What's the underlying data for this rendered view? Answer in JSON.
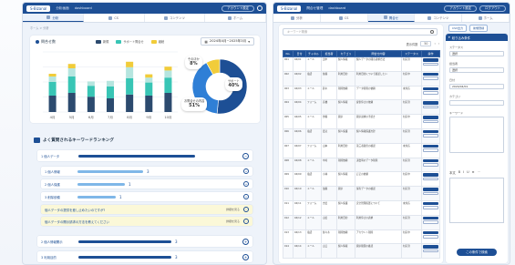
{
  "left": {
    "logo": "S-Bizanal",
    "nav": [
      "分析画面",
      "dashboard"
    ],
    "top_button": "アカウント設定",
    "subnav": [
      "分析",
      "CS",
      "コンテンツ",
      "ホーム"
    ],
    "breadcrumb": "ホーム > 分析",
    "chart_card": {
      "title": "問合せ数",
      "legend": [
        "新規",
        "サポート問合せ",
        "継続"
      ],
      "period": "2024年4月~2025年3月"
    },
    "donut_labels": [
      {
        "label": "そのほか",
        "value": "8%"
      },
      {
        "label": "サポート",
        "value": "40%"
      },
      {
        "label": "お問合せの内容",
        "value": "51%"
      }
    ],
    "ranking": {
      "title": "よく質問されるキーワードランキング",
      "items": [
        {
          "label": "1 個人データ",
          "count": "",
          "level": 1,
          "toggle": "−"
        },
        {
          "label": "1 個人情報",
          "count": "3",
          "level": 2,
          "toggle": "+"
        },
        {
          "label": "2 個人保護",
          "count": "1",
          "level": 2,
          "toggle": "+"
        },
        {
          "label": "3 削除依頼",
          "count": "1",
          "level": 2,
          "toggle": "+"
        },
        {
          "label": "個人データの提供を差し止めたいのですが?",
          "count": "",
          "level": 3,
          "ext": "詳細を見る"
        },
        {
          "label": "個人データの開示請求の方法を教えてください",
          "count": "",
          "level": 3,
          "ext": "詳細を見る"
        },
        {
          "label": "2 個人情報開示",
          "count": "3",
          "level": 1,
          "toggle": "+"
        },
        {
          "label": "3 利用目的",
          "count": "3",
          "level": 1,
          "toggle": "+"
        }
      ]
    }
  },
  "right": {
    "logo": "S-Bizanal",
    "nav": [
      "問合せ管理",
      "dashboard"
    ],
    "top_buttons": [
      "アカウント設定",
      "ログアウト"
    ],
    "subnav": [
      "分析",
      "CS",
      "問合せ",
      "コンテンツ",
      "ホーム"
    ],
    "search_placeholder": "キーワード検索",
    "pager": {
      "label": "表示件数",
      "value": "50"
    },
    "columns": [
      "No.",
      "日付",
      "チャネル",
      "担当者",
      "カテゴリ",
      "問合せ内容",
      "ステータス",
      "操作"
    ],
    "rows": [
      [
        "001",
        "04/01",
        "メール",
        "田中",
        "個人情報",
        "個人データの開示請求方法",
        "対応済",
        ""
      ],
      [
        "002",
        "04/02",
        "電話",
        "佐藤",
        "利用目的",
        "利用目的について確認したい",
        "対応中",
        ""
      ],
      [
        "003",
        "04/03",
        "メール",
        "鈴木",
        "削除依頼",
        "データ削除の依頼",
        "未対応",
        ""
      ],
      [
        "004",
        "04/04",
        "フォーム",
        "高橋",
        "個人情報",
        "提供停止の依頼",
        "対応済",
        ""
      ],
      [
        "005",
        "04/05",
        "メール",
        "伊藤",
        "開示",
        "開示請求の手続き",
        "対応中",
        ""
      ],
      [
        "006",
        "04/06",
        "電話",
        "渡辺",
        "個人保護",
        "個人情報保護方針",
        "対応済",
        ""
      ],
      [
        "007",
        "04/07",
        "フォーム",
        "山本",
        "利用目的",
        "第三者提供の確認",
        "未対応",
        ""
      ],
      [
        "008",
        "04/08",
        "メール",
        "中村",
        "削除依頼",
        "退会時のデータ削除",
        "対応済",
        ""
      ],
      [
        "009",
        "04/09",
        "電話",
        "小林",
        "個人情報",
        "訂正の依頼",
        "対応中",
        ""
      ],
      [
        "010",
        "04/10",
        "メール",
        "加藤",
        "開示",
        "保有データの確認",
        "対応済",
        ""
      ],
      [
        "011",
        "04/11",
        "フォーム",
        "吉田",
        "個人保護",
        "安全管理措置について",
        "未対応",
        ""
      ],
      [
        "012",
        "04/12",
        "メール",
        "山田",
        "利用目的",
        "利用停止の請求",
        "対応済",
        ""
      ],
      [
        "013",
        "04/13",
        "電話",
        "佐々木",
        "削除依頼",
        "アカウント削除",
        "対応中",
        ""
      ],
      [
        "014",
        "04/14",
        "メール",
        "山口",
        "個人情報",
        "開示範囲の確認",
        "対応済",
        ""
      ]
    ],
    "action_labels": [
      "詳細",
      "編集"
    ],
    "side_buttons": [
      "CSV出力",
      "新規登録"
    ],
    "filter": {
      "title": "絞り込み条件",
      "fields": [
        {
          "label": "ステータス",
          "value": "選択"
        },
        {
          "label": "担当者",
          "value": "選択"
        },
        {
          "label": "日付",
          "value": "2024/04/01"
        },
        {
          "label": "カテゴリ",
          "value": ""
        },
        {
          "label": "キーワード",
          "value": ""
        }
      ],
      "editor_tools": [
        "B",
        "I",
        "U",
        "≡",
        "⋯"
      ],
      "editor_label": "本文",
      "submit": "この条件で検索"
    }
  },
  "chart_data": [
    {
      "type": "bar",
      "stacked": true,
      "categories": [
        "4月",
        "5月",
        "6月",
        "7月",
        "8月",
        "9月",
        "10月"
      ],
      "series": [
        {
          "values": [
            30,
            35,
            28,
            25,
            32,
            30,
            35
          ],
          "color": "#2c4a6e"
        },
        {
          "values": [
            25,
            30,
            20,
            22,
            30,
            24,
            28
          ],
          "color": "#38c5b5"
        },
        {
          "values": [
            10,
            15,
            8,
            10,
            20,
            9,
            13
          ],
          "color": "#b6e5df"
        },
        {
          "values": [
            5,
            8,
            0,
            0,
            10,
            6,
            7
          ],
          "color": "#f1cc3a"
        }
      ],
      "ylim": [
        0,
        110
      ],
      "grid": true
    },
    {
      "type": "pie",
      "labels": [
        "お問合せの内容",
        "サポート",
        "そのほか"
      ],
      "values": [
        51,
        40,
        8
      ],
      "colors": [
        "#1d4f95",
        "#2f7fd6",
        "#f1cc3a"
      ],
      "donut": true
    }
  ]
}
